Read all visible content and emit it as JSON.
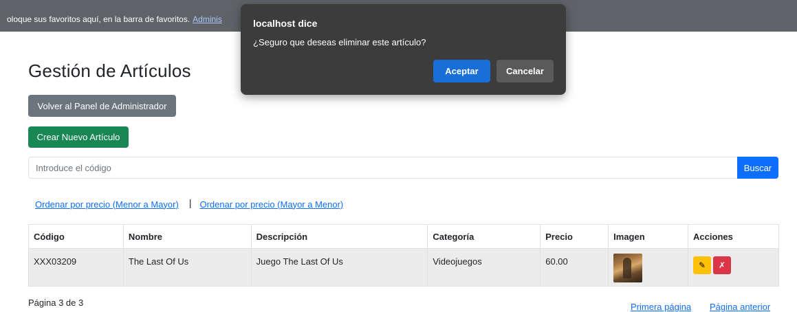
{
  "bookmarks_bar": {
    "text": "oloque sus favoritos aquí, en la barra de favoritos.",
    "link": "Adminis"
  },
  "page": {
    "title": "Gestión de Artículos",
    "back_button": "Volver al Panel de Administrador",
    "new_button": "Crear Nuevo Artículo"
  },
  "search": {
    "placeholder": "Introduce el código",
    "button": "Buscar"
  },
  "sort": {
    "asc": "Ordenar por precio (Menor a Mayor)",
    "separator": "|",
    "desc": "Ordenar por precio (Mayor a Menor)"
  },
  "table": {
    "headers": [
      "Código",
      "Nombre",
      "Descripción",
      "Categoría",
      "Precio",
      "Imagen",
      "Acciones"
    ],
    "rows": [
      {
        "codigo": "XXX03209",
        "nombre": "The Last Of Us",
        "descripcion": "Juego The Last Of Us",
        "categoria": "Videojuegos",
        "precio": "60.00",
        "edit_icon": "✎",
        "delete_icon": "✗"
      }
    ]
  },
  "pagination": {
    "info": "Página 3 de 3",
    "first": "Primera página",
    "prev": "Página anterior"
  },
  "dialog": {
    "title": "localhost dice",
    "message": "¿Seguro que deseas eliminar este artículo?",
    "ok": "Aceptar",
    "cancel": "Cancelar"
  },
  "colors": {
    "primary": "#0d6efd",
    "secondary": "#6c757d",
    "success": "#198754",
    "warning": "#ffc107",
    "danger": "#dc3545"
  }
}
